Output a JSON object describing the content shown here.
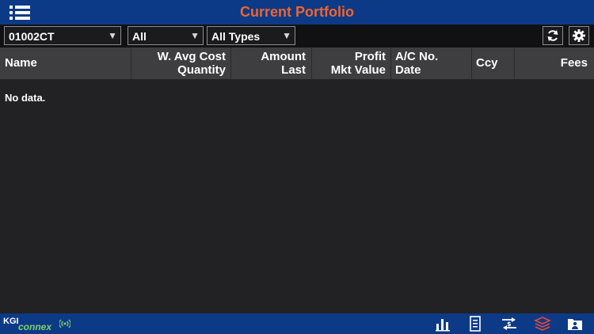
{
  "header": {
    "title": "Current Portfolio",
    "menu_icon": "menu-list-icon"
  },
  "filters": {
    "account": "01002CT",
    "market": "All",
    "type": "All Types"
  },
  "toolbar": {
    "refresh_icon": "refresh-icon",
    "settings_icon": "gear-icon"
  },
  "table": {
    "columns": [
      {
        "line1": "",
        "line2": "Name"
      },
      {
        "line1": "W. Avg Cost",
        "line2": "Quantity"
      },
      {
        "line1": "Amount",
        "line2": "Last"
      },
      {
        "line1": "Profit",
        "line2": "Mkt Value"
      },
      {
        "line1": "A/C No.",
        "line2": "Date"
      },
      {
        "line1": "",
        "line2": "Ccy"
      },
      {
        "line1": "",
        "line2": "Fees"
      }
    ],
    "empty_message": "No data."
  },
  "footer": {
    "brand_prefix": "KGI",
    "brand_name": "connex",
    "nav": [
      "chart-icon",
      "list-icon",
      "exchange-icon",
      "portfolio-icon",
      "account-icon"
    ],
    "active_nav": "portfolio-icon",
    "active_color": "#e8463a",
    "brand_accent": "#7fd16a"
  },
  "colors": {
    "title": "#f0642e",
    "bar": "#0d3a86",
    "background": "#222224",
    "header_row": "#3e3e40"
  }
}
